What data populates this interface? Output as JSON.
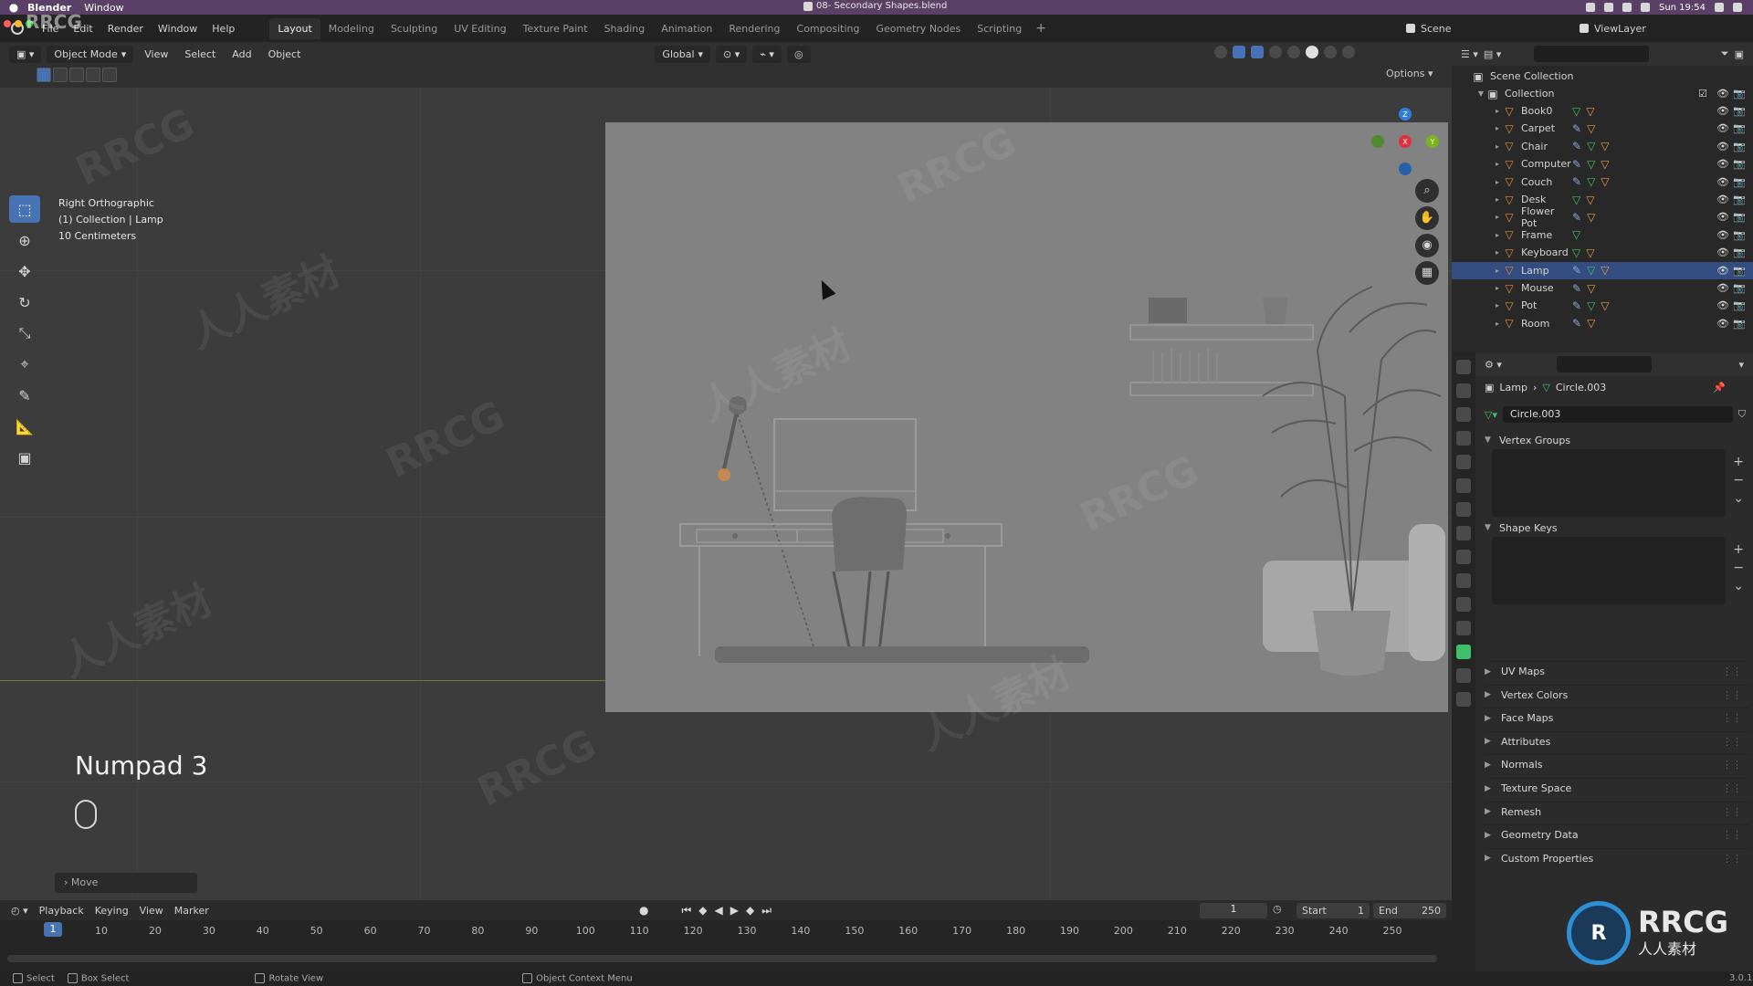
{
  "macbar": {
    "app": "Blender",
    "menu": "Window",
    "document": "08- Secondary Shapes.blend",
    "clock": "Sun 19:54"
  },
  "topbar": {
    "menus": [
      "File",
      "Edit",
      "Render",
      "Window",
      "Help"
    ],
    "workspaces": [
      "Layout",
      "Modeling",
      "Sculpting",
      "UV Editing",
      "Texture Paint",
      "Shading",
      "Animation",
      "Rendering",
      "Compositing",
      "Geometry Nodes",
      "Scripting"
    ],
    "active_workspace": "Layout",
    "scene": "Scene",
    "viewlayer": "ViewLayer"
  },
  "viewport_header": {
    "mode": "Object Mode",
    "menus": [
      "View",
      "Select",
      "Add",
      "Object"
    ],
    "orientation": "Global",
    "options": "Options"
  },
  "viewport": {
    "view_name": "Right Orthographic",
    "collection_info": "(1) Collection | Lamp",
    "scale": "10 Centimeters",
    "key_hint": "Numpad 3",
    "last_op": "Move"
  },
  "gizmo": {
    "x": "X",
    "y": "Y",
    "z": "Z"
  },
  "timeline": {
    "menus": [
      "Playback",
      "Keying",
      "View",
      "Marker"
    ],
    "current_frame": "1",
    "start_label": "Start",
    "start": "1",
    "end_label": "End",
    "end": "250",
    "ticks": [
      "1",
      "10",
      "20",
      "30",
      "40",
      "50",
      "60",
      "70",
      "80",
      "90",
      "100",
      "110",
      "120",
      "130",
      "140",
      "150",
      "160",
      "170",
      "180",
      "190",
      "200",
      "210",
      "220",
      "230",
      "240",
      "250"
    ]
  },
  "statusbar": {
    "select": "Select",
    "box_select": "Box Select",
    "rotate_view": "Rotate View",
    "context_menu": "Object Context Menu",
    "version": "3.0.1"
  },
  "outliner": {
    "scene_collection": "Scene Collection",
    "collection": "Collection",
    "items": [
      "Book0",
      "Carpet",
      "Chair",
      "Computer",
      "Couch",
      "Desk",
      "Flower Pot",
      "Frame",
      "Keyboard",
      "Lamp",
      "Mouse",
      "Pot",
      "Room"
    ],
    "selected": "Lamp"
  },
  "properties": {
    "object": "Lamp",
    "mesh": "Circle.003",
    "panels_open": [
      "Vertex Groups",
      "Shape Keys"
    ],
    "panels_closed": [
      "UV Maps",
      "Vertex Colors",
      "Face Maps",
      "Attributes",
      "Normals",
      "Texture Space",
      "Remesh",
      "Geometry Data",
      "Custom Properties"
    ]
  },
  "watermark": {
    "text": "RRCG",
    "cn": "人人素材",
    "logo_cn": "人人素材"
  },
  "colors": {
    "accent": "#4772b3",
    "selected_row": "#334d80",
    "mesh_icon": "#3ec06a",
    "object_icon": "#e08b3a"
  }
}
